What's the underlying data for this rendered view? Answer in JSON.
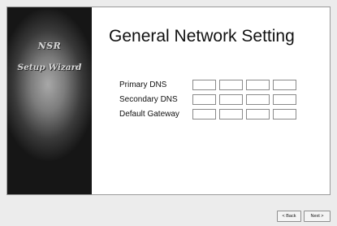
{
  "sidebar": {
    "line1": "NSR",
    "line2": "Setup Wizard"
  },
  "page_title": "General Network Setting",
  "fields": [
    {
      "label": "Primary DNS",
      "octets": [
        "",
        "",
        "",
        ""
      ]
    },
    {
      "label": "Secondary DNS",
      "octets": [
        "",
        "",
        "",
        ""
      ]
    },
    {
      "label": "Default Gateway",
      "octets": [
        "",
        "",
        "",
        ""
      ]
    }
  ],
  "buttons": {
    "back": "< Back",
    "next": "Next >"
  }
}
